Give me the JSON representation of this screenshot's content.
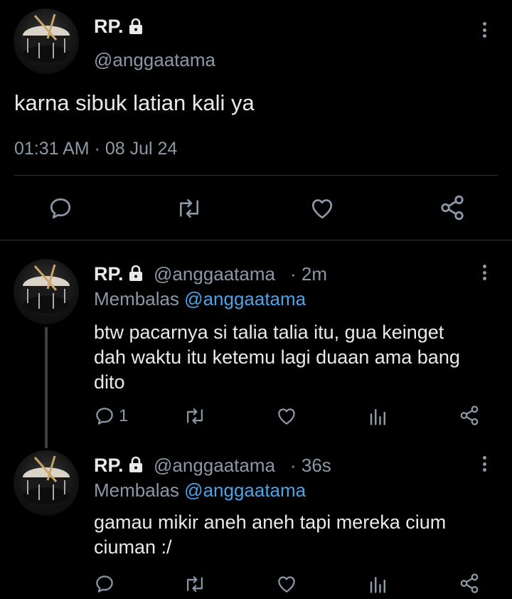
{
  "main_tweet": {
    "display_name": "RP.",
    "handle": "@anggaatama",
    "text": "karna sibuk latian kali ya",
    "timestamp": "01:31 AM · 08 Jul 24",
    "actions": [
      "reply-icon",
      "retweet-icon",
      "like-icon",
      "share-icon"
    ]
  },
  "replies": [
    {
      "display_name": "RP.",
      "handle": "@anggaatama",
      "time": "· 2m",
      "replying_prefix": "Membalas",
      "replying_to": "@anggaatama",
      "text_lines": [
        "btw pacarnya si talia talia itu, gua keinget",
        "dah waktu itu ketemu lagi duaan ama bang",
        "dito"
      ],
      "reply_count": "1"
    },
    {
      "display_name": "RP.",
      "handle": "@anggaatama",
      "time": "· 36s",
      "replying_prefix": "Membalas",
      "replying_to": "@anggaatama",
      "text_lines": [
        "gamau mikir aneh aneh tapi mereka cium",
        "ciuman :/"
      ],
      "reply_count": ""
    }
  ],
  "colors": {
    "background": "#000000",
    "text": "#e7e9ea",
    "muted": "#8b98a5",
    "link": "#4ea3e6",
    "divider": "#2f3336"
  }
}
